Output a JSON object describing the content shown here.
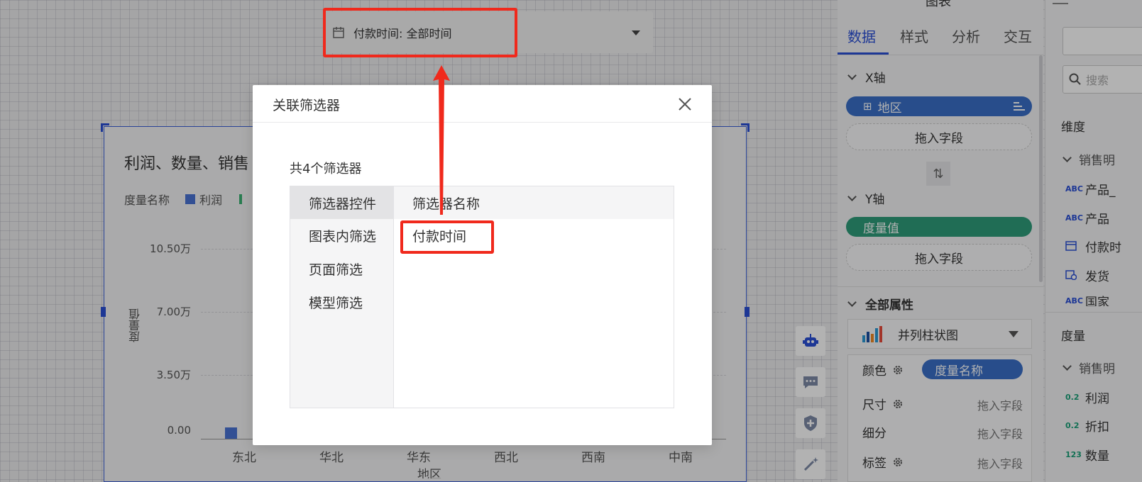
{
  "filter_widget": {
    "label": "付款时间: 全部时间"
  },
  "chart": {
    "title": "利润、数量、销售",
    "legend_title": "度量名称",
    "legend_items": [
      {
        "label": "利润",
        "color": "#4a73d4"
      },
      {
        "label": "",
        "color": "#3bb273"
      }
    ],
    "y_axis_label": "度量值",
    "x_axis_label": "地区",
    "y_ticks": [
      "10.50万",
      "7.00万",
      "3.50万",
      "0.00"
    ],
    "x_ticks": [
      "东北",
      "华北",
      "华东",
      "西北",
      "西南",
      "中南"
    ]
  },
  "chart_data": {
    "type": "bar",
    "title": "利润、数量、销售",
    "xlabel": "地区",
    "ylabel": "度量值",
    "categories": [
      "东北",
      "华北",
      "华东",
      "西北",
      "西南",
      "中南"
    ],
    "ylim": [
      0,
      105000
    ],
    "y_ticks": [
      "10.50万",
      "7.00万",
      "3.50万",
      "0.00"
    ],
    "legend": "top-left",
    "grid": true
  },
  "modal": {
    "title": "关联筛选器",
    "count_text": "共4个筛选器",
    "left_items": [
      "筛选器控件",
      "图表内筛选",
      "页面筛选",
      "模型筛选"
    ],
    "column_header": "筛选器名称",
    "rows": [
      "付款时间"
    ]
  },
  "panel": {
    "header": "图表",
    "tabs": [
      "数据",
      "样式",
      "分析",
      "交互"
    ],
    "x_axis": {
      "title": "X轴",
      "field": "地区",
      "drop_placeholder": "拖入字段"
    },
    "y_axis": {
      "title": "Y轴",
      "field": "度量值",
      "drop_placeholder": "拖入字段"
    },
    "all_props": "全部属性",
    "chart_type": "并列柱状图",
    "props": [
      {
        "label": "颜色",
        "value": "度量名称"
      },
      {
        "label": "尺寸",
        "value": "拖入字段"
      },
      {
        "label": "细分",
        "value": "拖入字段"
      },
      {
        "label": "标签",
        "value": "拖入字段"
      }
    ],
    "accent": "#2a4fd6",
    "pill_blue": "#3a6fc7",
    "pill_green": "#2e9c7a"
  },
  "side_panel": {
    "search_placeholder": "搜索",
    "dimension_title": "维度",
    "dimension_group": "销售明",
    "dimension_fields": [
      {
        "icon": "ABC",
        "label": "产品_"
      },
      {
        "icon": "ABC",
        "label": "产品"
      },
      {
        "icon": "date-icon",
        "label": "付款时"
      },
      {
        "icon": "date-time-icon",
        "label": "发货"
      },
      {
        "icon": "ABC",
        "label": "国家"
      }
    ],
    "measure_title": "度量",
    "measure_group": "销售明",
    "measure_fields": [
      {
        "icon": "0.2",
        "label": "利润"
      },
      {
        "icon": "0.2",
        "label": "折扣"
      },
      {
        "icon": "123",
        "label": "数量"
      }
    ]
  }
}
